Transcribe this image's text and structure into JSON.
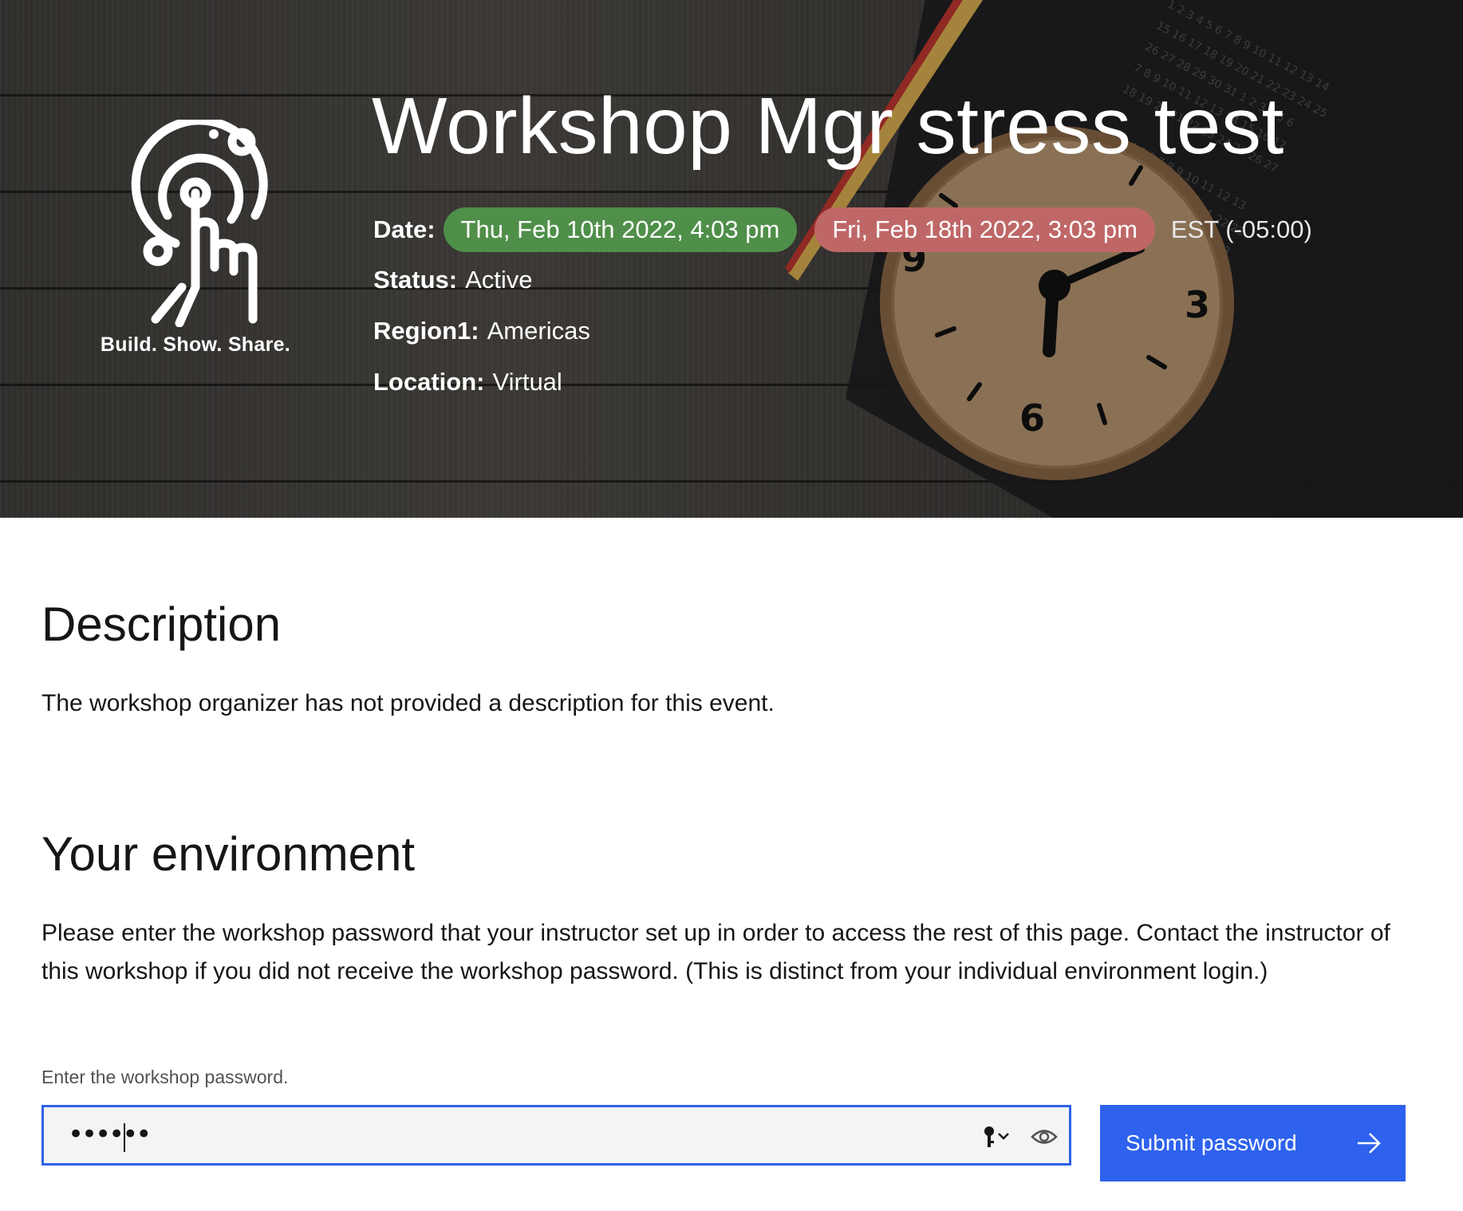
{
  "hero": {
    "tagline": "Build. Show. Share.",
    "title": "Workshop Mgr stress test",
    "date_label": "Date:",
    "start_date": "Thu, Feb 10th 2022, 4:03 pm",
    "end_date": "Fri, Feb 18th 2022, 3:03 pm",
    "timezone": "EST (-05:00)",
    "status_label": "Status:",
    "status_value": "Active",
    "region_label": "Region1:",
    "region_value": "Americas",
    "location_label": "Location:",
    "location_value": "Virtual"
  },
  "description": {
    "heading": "Description",
    "text": "The workshop organizer has not provided a description for this event."
  },
  "environment": {
    "heading": "Your environment",
    "text": "Please enter the workshop password that your instructor set up in order to access the rest of this page. Contact the instructor of this workshop if you did not receive the workshop password. (This is distinct from your individual environment login.)",
    "field_label": "Enter the workshop password.",
    "password_masked": "••••••",
    "submit_label": "Submit password"
  },
  "icons": [
    "touch-signal-logo-icon",
    "key-icon",
    "chevron-down-icon",
    "eye-icon",
    "arrow-right-icon"
  ],
  "colors": {
    "start_pill": "#4f8f49",
    "end_pill": "#bf6767",
    "focus_border": "#2d62e8",
    "primary_button": "#2e62ee"
  }
}
